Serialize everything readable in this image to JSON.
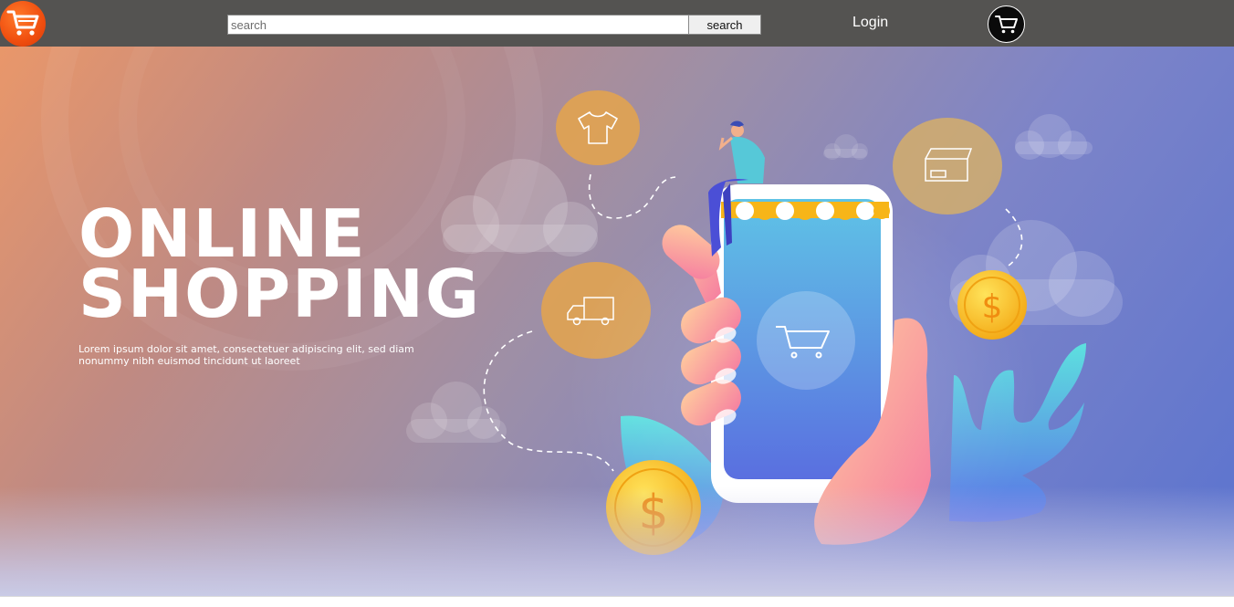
{
  "header": {
    "search": {
      "placeholder": "search",
      "value": ""
    },
    "search_button_label": "search",
    "login_label": "Login",
    "icons": {
      "logo": "cart-icon",
      "cart": "cart-icon"
    },
    "colors": {
      "navbar": "#545351",
      "logo": "#f04e0f",
      "cart_button": "#0a0a0a"
    }
  },
  "hero": {
    "title_line_1": "ONLINE",
    "title_line_2": "SHOPPING",
    "body_text": "Lorem ipsum dolor sit amet, consectetuer adipiscing elit, sed diam nonummy nibh euismod tincidunt ut laoreet",
    "illustration": {
      "icons": [
        "tshirt-icon",
        "delivery-truck-icon",
        "package-box-icon",
        "shopping-cart-icon",
        "dollar-coin-icon"
      ],
      "coin_symbol": "$"
    },
    "colors": {
      "gradient_start": "#e9976a",
      "gradient_end": "#5a73cf"
    }
  }
}
